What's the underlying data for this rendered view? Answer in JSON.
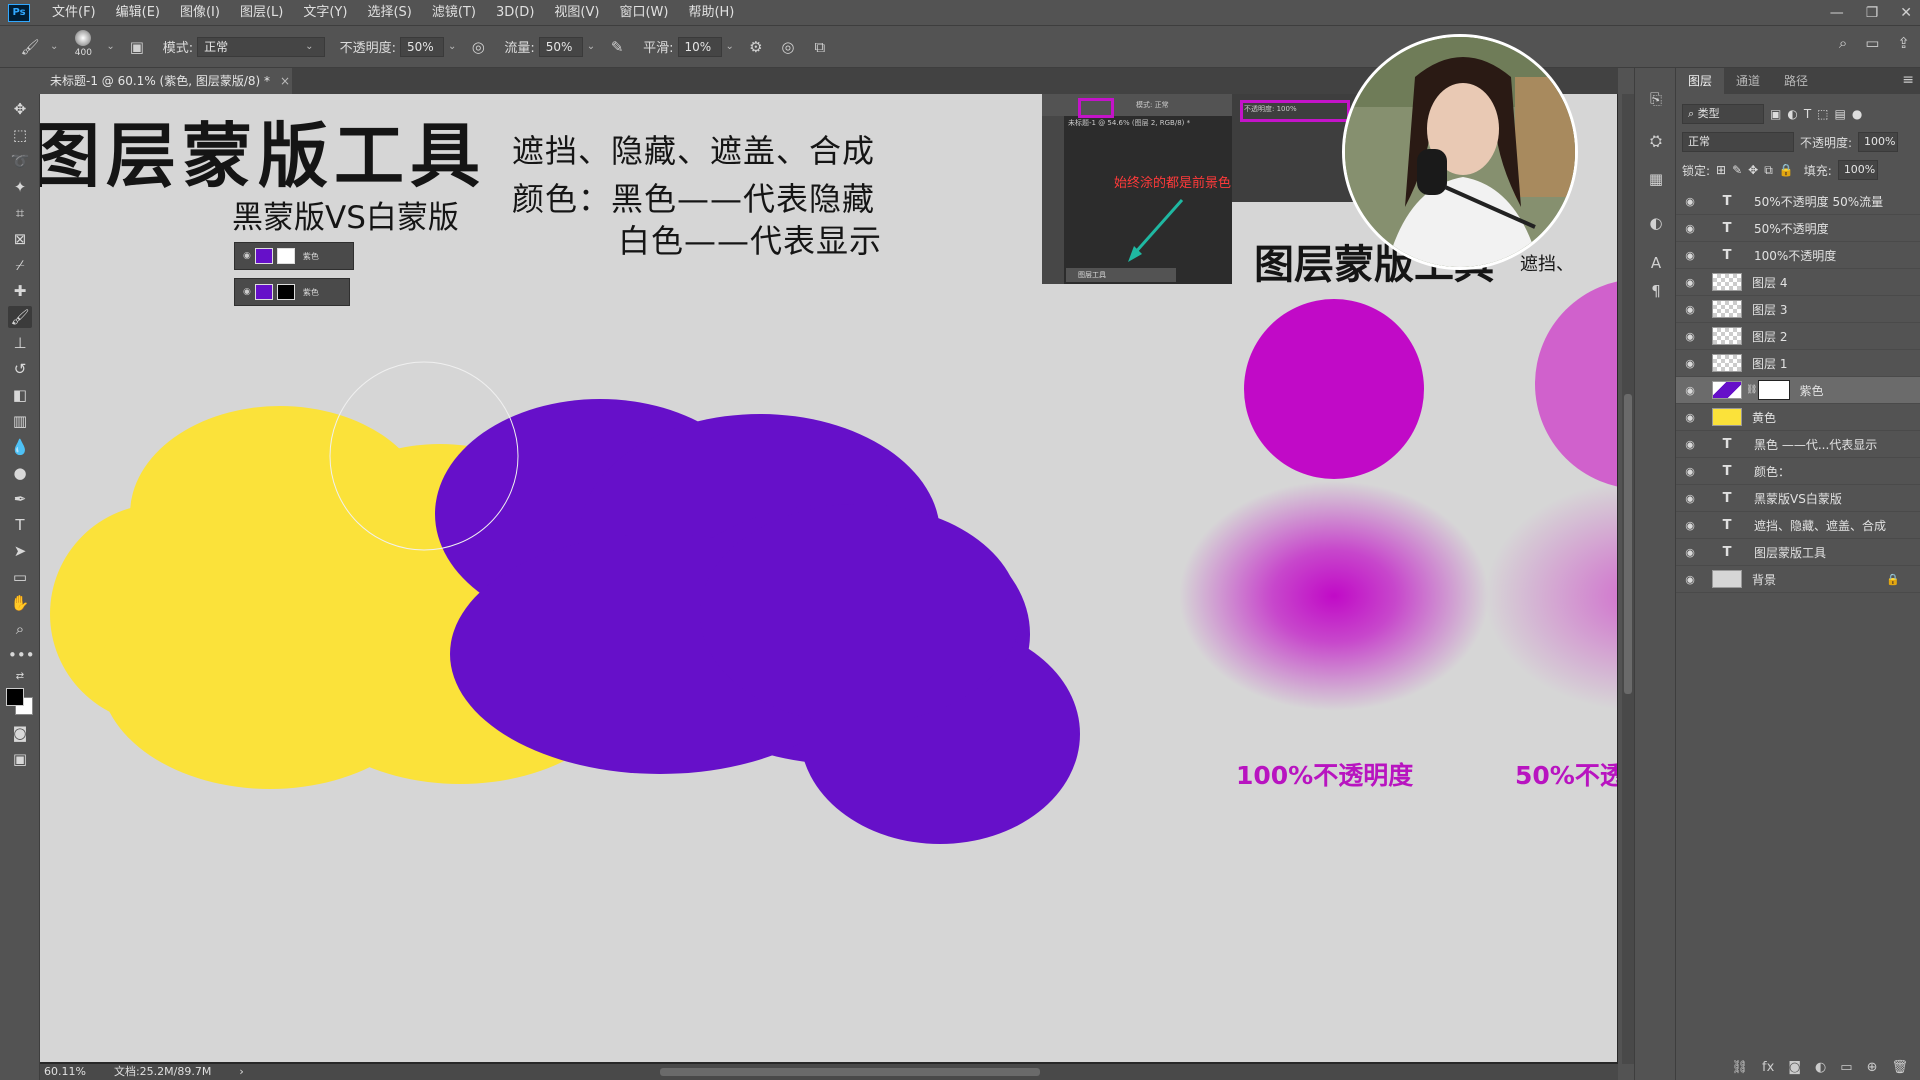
{
  "menubar": {
    "logo": "Ps",
    "items": [
      "文件(F)",
      "编辑(E)",
      "图像(I)",
      "图层(L)",
      "文字(Y)",
      "选择(S)",
      "滤镜(T)",
      "3D(D)",
      "视图(V)",
      "窗口(W)",
      "帮助(H)"
    ],
    "window_controls": [
      "—",
      "❐",
      "✕"
    ]
  },
  "options": {
    "brush_size": "400",
    "mode_label": "模式:",
    "mode_value": "正常",
    "opacity_label": "不透明度:",
    "opacity_value": "50%",
    "flow_label": "流量:",
    "flow_value": "50%",
    "smooth_label": "平滑:",
    "smooth_value": "10%"
  },
  "document": {
    "tab_title": "未标题-1 @ 60.1% (紫色, 图层蒙版/8) *",
    "tab_close": "×",
    "zoom": "60.11%",
    "doc_size": "文档:25.2M/89.7M"
  },
  "canvas": {
    "main_title": "图层蒙版工具",
    "sub_title": "黑蒙版VS白蒙版",
    "desc_1": "遮挡、隐藏、遮盖、合成",
    "desc_2": "颜色：黑色——代表隐藏",
    "desc_3": "白色——代表显示",
    "mini_layer_text": "紫色",
    "inset_note": "始终涂的都是前景色",
    "inset_mode": "模式:  正常",
    "inset_tab": "未标题-1 @ 54.6% (图层 2, RGB/8) *",
    "inset_panel": "图层工具",
    "inset_opacity": "不透明度:  100%",
    "mini_title": "图层蒙版工具",
    "mini_desc": "遮挡、",
    "label_100": "100%不透明度",
    "label_50": "50%不透"
  },
  "colors": {
    "yellow": "#fbe23a",
    "purple": "#6610c9",
    "magenta": "#c10ac7",
    "magenta_light": "#d061cc",
    "label_magenta": "#b814c0"
  },
  "layers_panel": {
    "tabs": [
      "图层",
      "通道",
      "路径"
    ],
    "filter_label": "类型",
    "blend_mode": "正常",
    "opacity_label": "不透明度:",
    "opacity_value": "100%",
    "lock_label": "锁定:",
    "fill_label": "填充:",
    "fill_value": "100%",
    "layers": [
      {
        "type": "text",
        "name": "50%不透明度  50%流量"
      },
      {
        "type": "text",
        "name": "50%不透明度"
      },
      {
        "type": "text",
        "name": "100%不透明度"
      },
      {
        "type": "pixel",
        "name": "图层 4"
      },
      {
        "type": "pixel",
        "name": "图层 3"
      },
      {
        "type": "pixel",
        "name": "图层 2"
      },
      {
        "type": "pixel",
        "name": "图层 1"
      },
      {
        "type": "mask",
        "name": "紫色"
      },
      {
        "type": "yellow",
        "name": "黄色"
      },
      {
        "type": "text",
        "name": "黑色 ——代...代表显示"
      },
      {
        "type": "text",
        "name": "颜色："
      },
      {
        "type": "text",
        "name": "黑蒙版VS白蒙版"
      },
      {
        "type": "text",
        "name": "遮挡、隐藏、遮盖、合成"
      },
      {
        "type": "text",
        "name": "图层蒙版工具"
      },
      {
        "type": "background",
        "name": "背景"
      }
    ]
  }
}
